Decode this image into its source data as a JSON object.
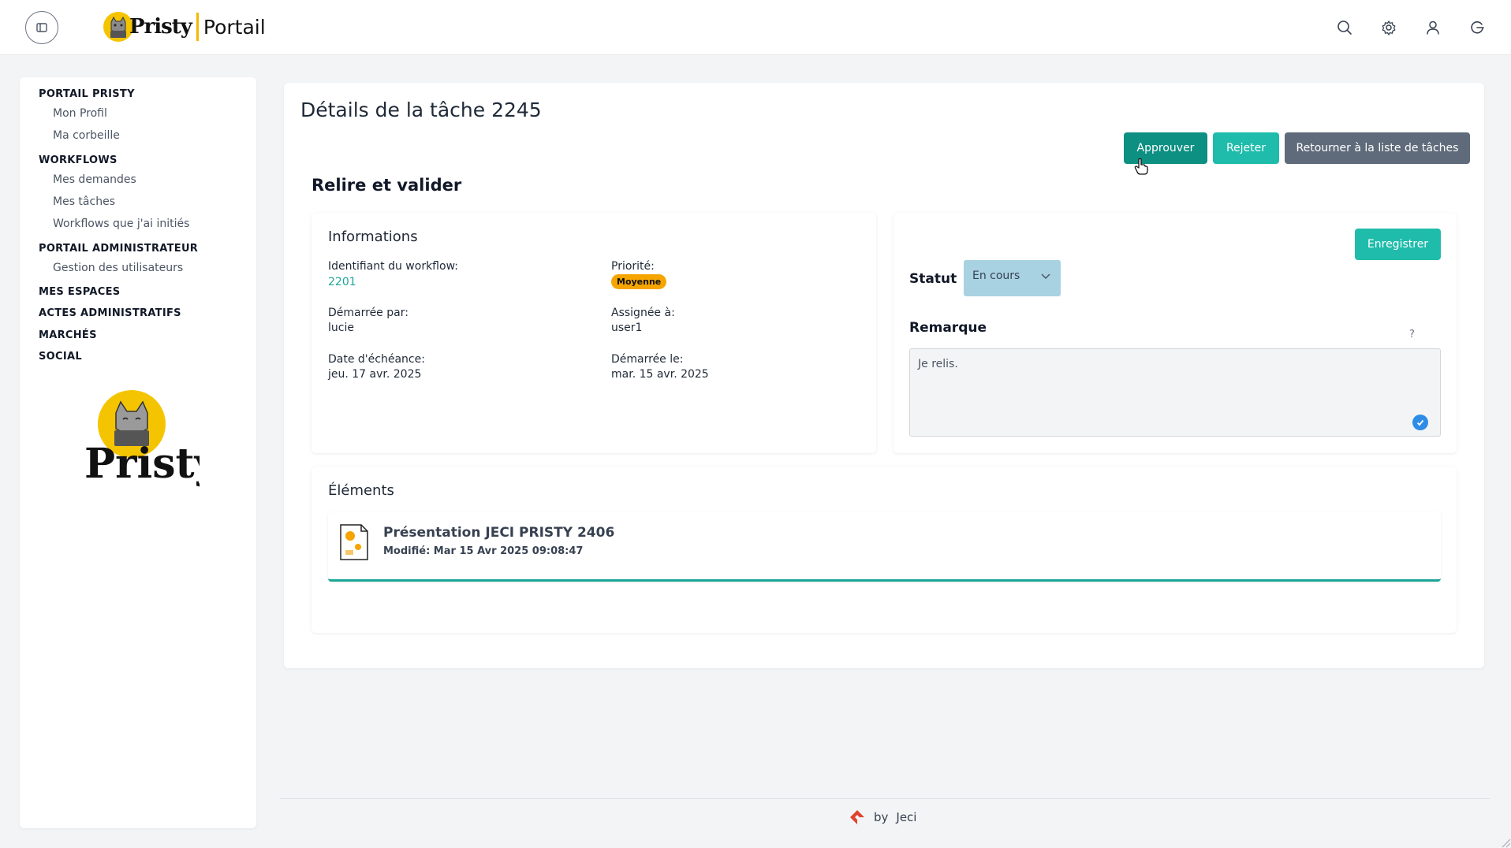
{
  "header": {
    "logo_word": "Pristy",
    "logo_portail": "Portail"
  },
  "sidebar": {
    "sections": [
      {
        "label": "PORTAIL PRISTY",
        "items": [
          "Mon Profil",
          "Ma corbeille"
        ]
      },
      {
        "label": "WORKFLOWS",
        "items": [
          "Mes demandes",
          "Mes tâches",
          "Workflows que j'ai initiés"
        ]
      },
      {
        "label": "PORTAIL ADMINISTRATEUR",
        "items": [
          "Gestion des utilisateurs"
        ]
      },
      {
        "label": "MES ESPACES",
        "items": []
      },
      {
        "label": "ACTES ADMINISTRATIFS",
        "items": []
      },
      {
        "label": "MARCHÉS",
        "items": []
      },
      {
        "label": "SOCIAL",
        "items": []
      }
    ],
    "logo_word": "Pristy"
  },
  "main": {
    "title": "Détails de la tâche 2245",
    "buttons": {
      "approve": "Approuver",
      "reject": "Rejeter",
      "return": "Retourner à la liste de tâches"
    },
    "section_title": "Relire et valider",
    "info": {
      "title": "Informations",
      "workflow_id_label": "Identifiant du workflow:",
      "workflow_id": "2201",
      "priority_label": "Priorité:",
      "priority": "Moyenne",
      "started_by_label": "Démarrée par:",
      "started_by": "lucie",
      "assigned_label": "Assignée à:",
      "assigned": "user1",
      "due_label": "Date d'échéance:",
      "due": "jeu. 17 avr. 2025",
      "started_on_label": "Démarrée le:",
      "started_on": "mar. 15 avr. 2025"
    },
    "form": {
      "save": "Enregistrer",
      "status_label": "Statut",
      "status_value": "En cours",
      "remark_label": "Remarque",
      "help": "?",
      "remark_value": "Je relis."
    },
    "elements": {
      "title": "Éléments",
      "items": [
        {
          "name": "Présentation JECI PRISTY 2406",
          "modified": "Modifié: Mar 15 Avr 2025 09:08:47"
        }
      ]
    }
  },
  "footer": {
    "by": "by",
    "company": "Jeci"
  },
  "colors": {
    "approve": "#0d8f82",
    "reject": "#1fbcab",
    "return": "#5f6b7a",
    "priority_badge": "#f5a400",
    "status_select": "#a8d2e2",
    "link": "#1aa697"
  }
}
